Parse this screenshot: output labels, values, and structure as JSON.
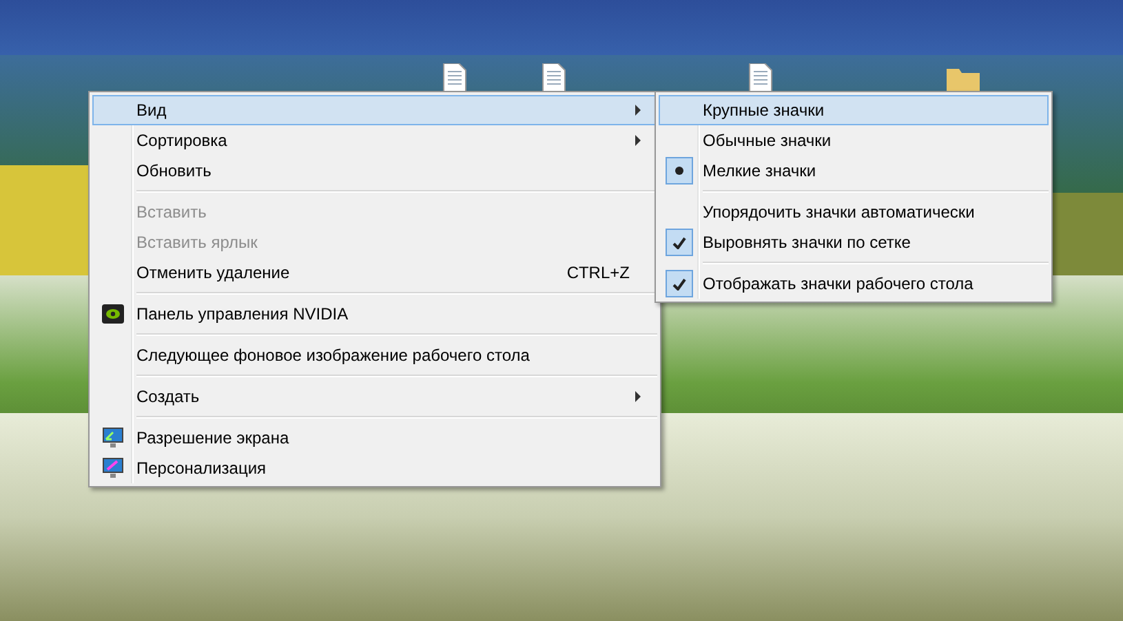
{
  "context_menu": {
    "items": [
      {
        "kind": "item",
        "label": "Вид",
        "selected": true,
        "disabled": false,
        "submenu": true
      },
      {
        "kind": "item",
        "label": "Сортировка",
        "selected": false,
        "disabled": false,
        "submenu": true
      },
      {
        "kind": "item",
        "label": "Обновить",
        "selected": false,
        "disabled": false,
        "submenu": false
      },
      {
        "kind": "separator"
      },
      {
        "kind": "item",
        "label": "Вставить",
        "selected": false,
        "disabled": true,
        "submenu": false
      },
      {
        "kind": "item",
        "label": "Вставить ярлык",
        "selected": false,
        "disabled": true,
        "submenu": false
      },
      {
        "kind": "item",
        "label": "Отменить удаление",
        "shortcut": "CTRL+Z",
        "selected": false,
        "disabled": false,
        "submenu": false
      },
      {
        "kind": "separator"
      },
      {
        "kind": "item",
        "label": "Панель управления NVIDIA",
        "selected": false,
        "disabled": false,
        "submenu": false
      },
      {
        "kind": "separator"
      },
      {
        "kind": "item",
        "label": "Следующее фоновое изображение рабочего стола",
        "selected": false,
        "disabled": false,
        "submenu": false
      },
      {
        "kind": "separator"
      },
      {
        "kind": "item",
        "label": "Создать",
        "selected": false,
        "disabled": false,
        "submenu": true
      },
      {
        "kind": "separator"
      },
      {
        "kind": "item",
        "label": "Разрешение экрана",
        "selected": false,
        "disabled": false,
        "submenu": false
      },
      {
        "kind": "item",
        "label": "Персонализация",
        "selected": false,
        "disabled": false,
        "submenu": false
      }
    ]
  },
  "view_submenu": {
    "items": [
      {
        "kind": "radio",
        "label": "Крупные значки",
        "selected": true,
        "checked": false
      },
      {
        "kind": "radio",
        "label": "Обычные значки",
        "selected": false,
        "checked": false
      },
      {
        "kind": "radio",
        "label": "Мелкие значки",
        "selected": false,
        "checked": true
      },
      {
        "kind": "separator"
      },
      {
        "kind": "check",
        "label": "Упорядочить значки автоматически",
        "selected": false,
        "checked": false
      },
      {
        "kind": "check",
        "label": "Выровнять значки по сетке",
        "selected": false,
        "checked": true
      },
      {
        "kind": "separator"
      },
      {
        "kind": "check",
        "label": "Отображать значки рабочего стола",
        "selected": false,
        "checked": true
      }
    ]
  }
}
